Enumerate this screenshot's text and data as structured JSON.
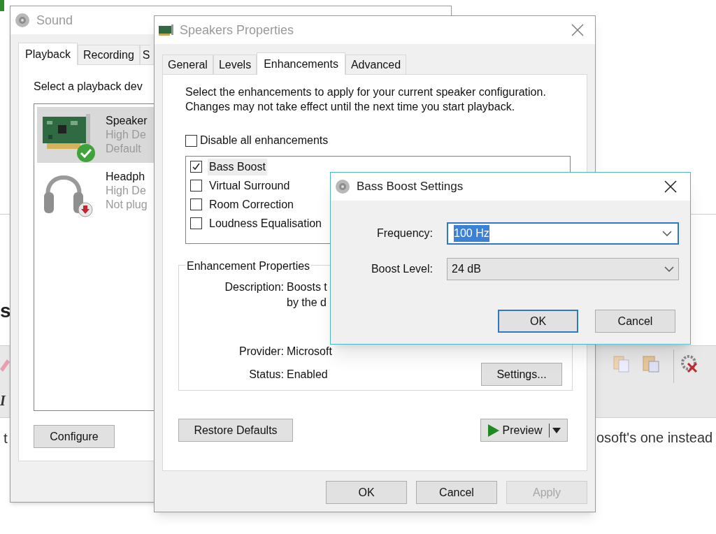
{
  "background_page": {
    "heading_fragment": "s",
    "italic_button": "I",
    "line_fragment_left": "t",
    "line_fragment_right": "osoft's one instead"
  },
  "sound_window": {
    "title": "Sound",
    "tabs": [
      {
        "label": "Playback",
        "selected": true
      },
      {
        "label": "Recording",
        "selected": false
      },
      {
        "label": "S",
        "selected": false
      }
    ],
    "instruction": "Select a playback dev",
    "devices": [
      {
        "kind": "card",
        "default": true,
        "unplugged": false,
        "name": "Speaker",
        "line_2": "High De",
        "line_3": "Default",
        "selected": true
      },
      {
        "kind": "headphones",
        "default": false,
        "unplugged": true,
        "name": "Headph",
        "line_2": "High De",
        "line_3": "Not plug",
        "selected": false
      }
    ],
    "configure_button": "Configure"
  },
  "speakers_properties": {
    "title": "Speakers Properties",
    "tabs": [
      {
        "label": "General",
        "selected": false
      },
      {
        "label": "Levels",
        "selected": false
      },
      {
        "label": "Enhancements",
        "selected": true
      },
      {
        "label": "Advanced",
        "selected": false
      }
    ],
    "intro": "Select the enhancements to apply for your current speaker configuration. Changes may not take effect until the next time you start playback.",
    "disable_all": {
      "label": "Disable all enhancements",
      "checked": false
    },
    "enhancements": [
      {
        "label": "Bass Boost",
        "checked": true,
        "selected": true
      },
      {
        "label": "Virtual Surround",
        "checked": false,
        "selected": false
      },
      {
        "label": "Room Correction",
        "checked": false,
        "selected": false
      },
      {
        "label": "Loudness Equalisation",
        "checked": false,
        "selected": false
      }
    ],
    "properties": {
      "legend": "Enhancement Properties",
      "description_label": "Description:",
      "description_lines": [
        "Boosts t",
        "by the d"
      ],
      "provider_label": "Provider:",
      "provider": "Microsoft",
      "status_label": "Status:",
      "status": "Enabled",
      "settings_button": "Settings..."
    },
    "restore_button": "Restore Defaults",
    "preview_button": "Preview",
    "buttons": [
      {
        "label": "OK",
        "disabled": false
      },
      {
        "label": "Cancel",
        "disabled": false
      },
      {
        "label": "Apply",
        "disabled": true
      }
    ]
  },
  "bass_boost_settings": {
    "title": "Bass Boost Settings",
    "fields": [
      {
        "label": "Frequency:",
        "value": "100 Hz",
        "focused": true
      },
      {
        "label": "Boost Level:",
        "value": "24 dB",
        "focused": false
      }
    ],
    "buttons": [
      {
        "label": "OK",
        "default": true
      },
      {
        "label": "Cancel",
        "default": false
      }
    ]
  }
}
